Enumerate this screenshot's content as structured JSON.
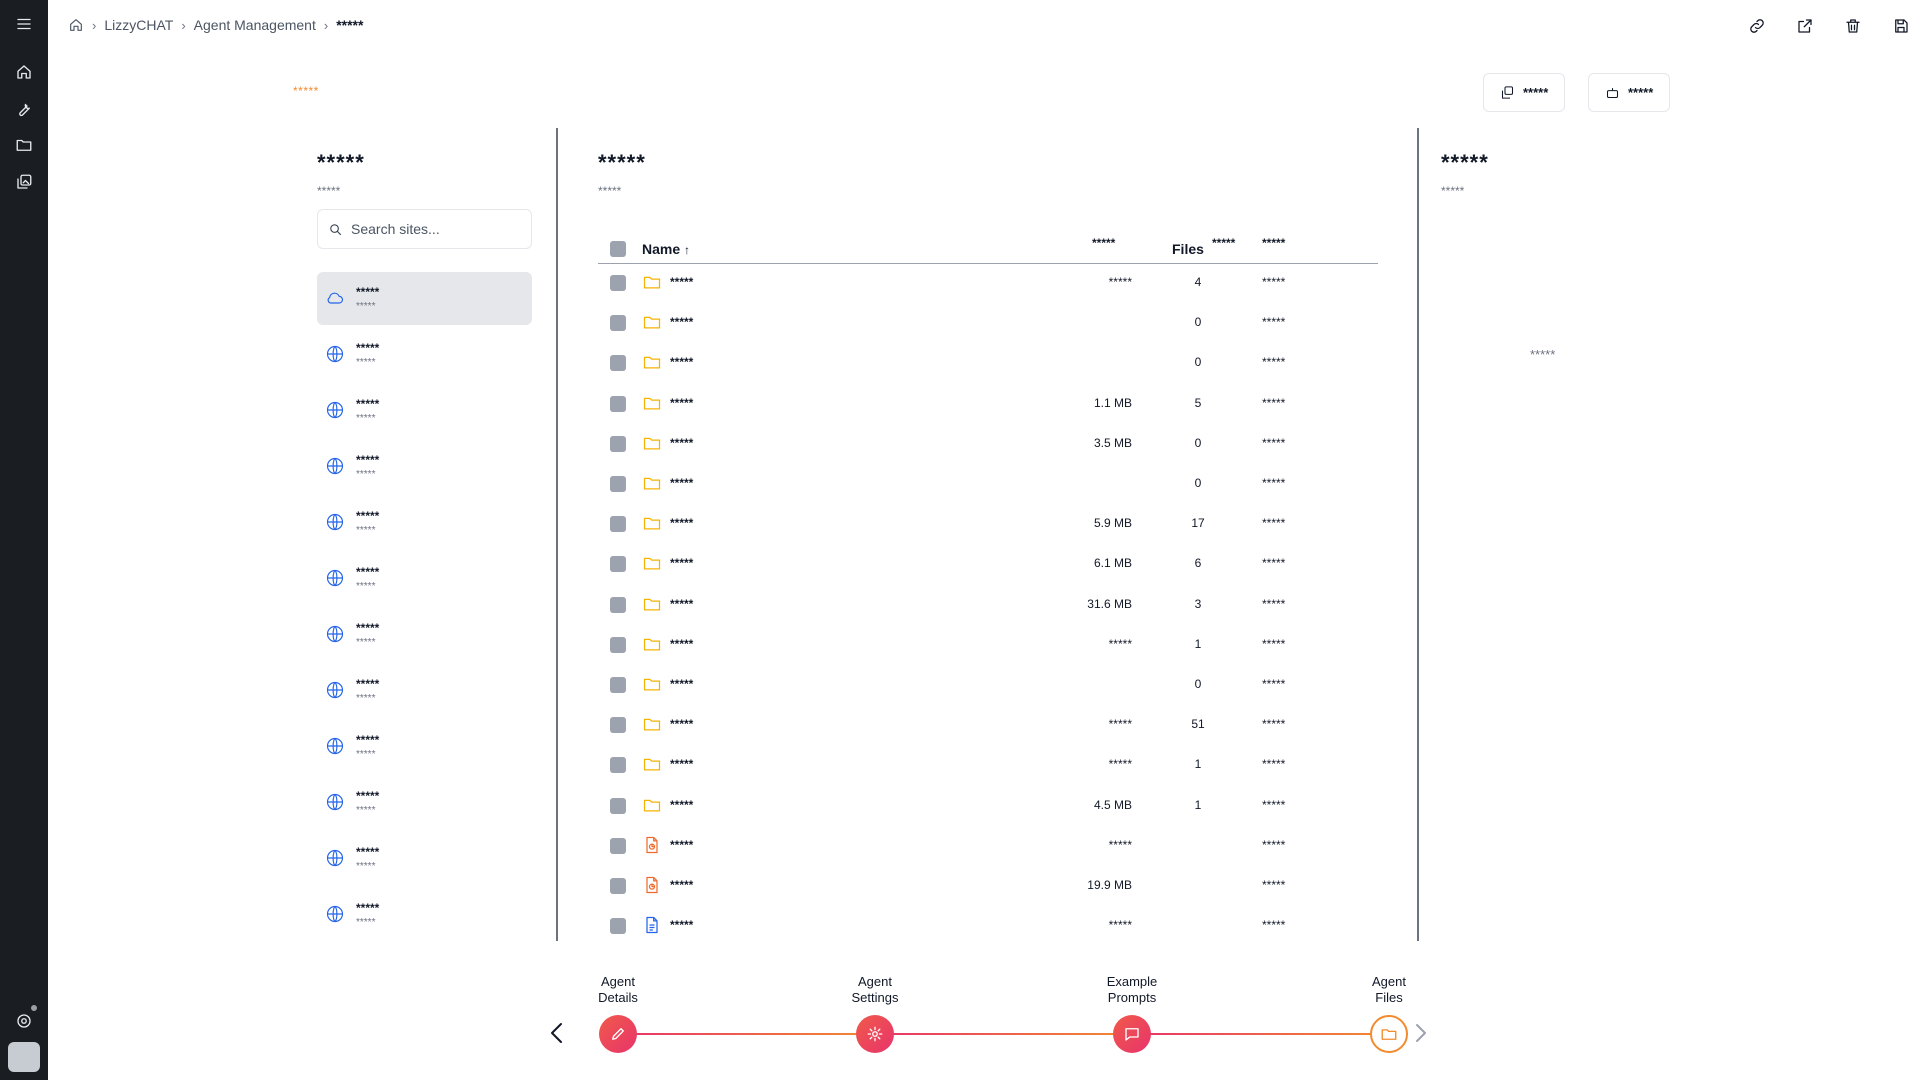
{
  "breadcrumb": {
    "items": [
      "LizzyCHAT",
      "Agent Management"
    ],
    "current": "*****"
  },
  "header": {
    "orange_label": "*****",
    "buttons": [
      "*****",
      "*****"
    ]
  },
  "sites_panel": {
    "title": "*****",
    "subtitle": "*****",
    "search_placeholder": "Search sites...",
    "items": [
      {
        "name": "*****",
        "sub": "*****",
        "icon": "cloud-icon",
        "active": true
      },
      {
        "name": "*****",
        "sub": "*****",
        "icon": "globe-icon"
      },
      {
        "name": "*****",
        "sub": "*****",
        "icon": "globe-icon"
      },
      {
        "name": "*****",
        "sub": "*****",
        "icon": "globe-icon"
      },
      {
        "name": "*****",
        "sub": "*****",
        "icon": "globe-icon"
      },
      {
        "name": "*****",
        "sub": "*****",
        "icon": "globe-icon"
      },
      {
        "name": "*****",
        "sub": "*****",
        "icon": "globe-icon"
      },
      {
        "name": "*****",
        "sub": "*****",
        "icon": "globe-icon"
      },
      {
        "name": "*****",
        "sub": "*****",
        "icon": "globe-icon"
      },
      {
        "name": "*****",
        "sub": "*****",
        "icon": "globe-icon"
      },
      {
        "name": "*****",
        "sub": "*****",
        "icon": "globe-icon"
      },
      {
        "name": "*****",
        "sub": "*****",
        "icon": "globe-icon"
      }
    ]
  },
  "files_panel": {
    "title": "*****",
    "subtitle": "*****",
    "columns": {
      "name": "Name",
      "sort_arrow": "↑",
      "size": "*****",
      "files": "Files",
      "col4": "*****",
      "modified": "*****"
    },
    "rows": [
      {
        "type": "folder",
        "name": "*****",
        "size": "*****",
        "files": "4",
        "modified": "*****"
      },
      {
        "type": "folder",
        "name": "*****",
        "size": "",
        "files": "0",
        "modified": "*****"
      },
      {
        "type": "folder",
        "name": "*****",
        "size": "",
        "files": "0",
        "modified": "*****"
      },
      {
        "type": "folder",
        "name": "*****",
        "size": "1.1 MB",
        "files": "5",
        "modified": "*****"
      },
      {
        "type": "folder",
        "name": "*****",
        "size": "3.5 MB",
        "files": "0",
        "modified": "*****"
      },
      {
        "type": "folder",
        "name": "*****",
        "size": "",
        "files": "0",
        "modified": "*****"
      },
      {
        "type": "folder",
        "name": "*****",
        "size": "5.9 MB",
        "files": "17",
        "modified": "*****"
      },
      {
        "type": "folder",
        "name": "*****",
        "size": "6.1 MB",
        "files": "6",
        "modified": "*****"
      },
      {
        "type": "folder",
        "name": "*****",
        "size": "31.6 MB",
        "files": "3",
        "modified": "*****"
      },
      {
        "type": "folder",
        "name": "*****",
        "size": "*****",
        "files": "1",
        "modified": "*****"
      },
      {
        "type": "folder",
        "name": "*****",
        "size": "",
        "files": "0",
        "modified": "*****"
      },
      {
        "type": "folder",
        "name": "*****",
        "size": "*****",
        "files": "51",
        "modified": "*****"
      },
      {
        "type": "folder",
        "name": "*****",
        "size": "*****",
        "files": "1",
        "modified": "*****"
      },
      {
        "type": "folder",
        "name": "*****",
        "size": "4.5 MB",
        "files": "1",
        "modified": "*****"
      },
      {
        "type": "file-orange",
        "name": "*****",
        "size": "*****",
        "files": "",
        "modified": "*****"
      },
      {
        "type": "file-orange",
        "name": "*****",
        "size": "19.9 MB",
        "files": "",
        "modified": "*****"
      },
      {
        "type": "file-blue",
        "name": "*****",
        "size": "*****",
        "files": "",
        "modified": "*****"
      }
    ]
  },
  "detail_panel": {
    "title": "*****",
    "subtitle": "*****",
    "empty_text": "*****"
  },
  "stepper": {
    "steps": [
      {
        "label_line1": "Agent",
        "label_line2": "Details",
        "icon": "pencil-icon",
        "state": "done"
      },
      {
        "label_line1": "Agent",
        "label_line2": "Settings",
        "icon": "gear-icon",
        "state": "done"
      },
      {
        "label_line1": "Example",
        "label_line2": "Prompts",
        "icon": "chat-icon",
        "state": "done"
      },
      {
        "label_line1": "Agent",
        "label_line2": "Files",
        "icon": "folder-icon",
        "state": "current"
      }
    ]
  },
  "colors": {
    "accent_orange": "#f28b30",
    "accent_red": "#e8336b",
    "folder_yellow": "#f5b301",
    "link_blue": "#2563eb",
    "rail_bg": "#1a1d21"
  }
}
